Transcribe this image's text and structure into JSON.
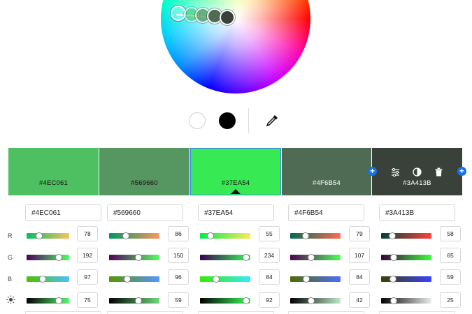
{
  "colors": {
    "accent": "#1473e6",
    "selection_outline": "#3b82f6"
  },
  "tools": {
    "white_icon": "white-circle-icon",
    "black_icon": "black-circle-icon",
    "eyedropper_icon": "eyedropper-icon"
  },
  "swatches": [
    {
      "hex": "#4EC061",
      "selected": false
    },
    {
      "hex": "#569660",
      "selected": false
    },
    {
      "hex": "#37EA54",
      "selected": true
    },
    {
      "hex": "#4F6B54",
      "selected": false
    },
    {
      "hex": "#3A413B",
      "selected": false
    }
  ],
  "swatch_tools": [
    "adjust-sliders-icon",
    "contrast-icon",
    "trash-icon"
  ],
  "row_labels": {
    "r": "R",
    "g": "G",
    "b": "B",
    "brightness_icon": "brightness-icon"
  },
  "rows": {
    "r": [
      "78",
      "86",
      "55",
      "79",
      "58"
    ],
    "g": [
      "192",
      "150",
      "234",
      "107",
      "65"
    ],
    "b": [
      "97",
      "96",
      "84",
      "84",
      "59"
    ],
    "brightness": [
      "75",
      "59",
      "92",
      "42",
      "25"
    ]
  }
}
